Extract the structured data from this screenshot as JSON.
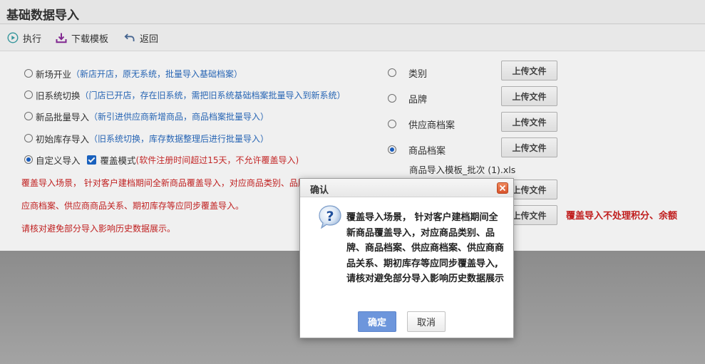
{
  "header": {
    "title": "基础数据导入"
  },
  "toolbar": {
    "run_label": "执行",
    "download_label": "下载模板",
    "back_label": "返回"
  },
  "import_options": [
    {
      "label": "新场开业",
      "note": "（新店开店，原无系统，批量导入基础档案）",
      "checked": false
    },
    {
      "label": "旧系统切换",
      "note": "（门店已开店，存在旧系统，需把旧系统基础档案批量导入到新系统）",
      "checked": false
    },
    {
      "label": "新品批量导入",
      "note": "（新引进供应商新增商品，商品档案批量导入）",
      "checked": false
    },
    {
      "label": "初始库存导入",
      "note": "（旧系统切换，库存数据整理后进行批量导入）",
      "checked": false
    },
    {
      "label": "自定义导入",
      "checked": true
    }
  ],
  "overwrite": {
    "label": "覆盖模式",
    "warning": "(软件注册时间超过15天，不允许覆盖导入)",
    "checked": true
  },
  "overwrite_description": {
    "line1": "覆盖导入场景， 针对客户建档期间全新商品覆盖导入，对应商品类别、品牌",
    "line2": "应商档案、供应商商品关系、期初库存等应同步覆盖导入。",
    "line3": "请核对避免部分导入影响历史数据展示。"
  },
  "categories": [
    {
      "label": "类别",
      "checked": false
    },
    {
      "label": "品牌",
      "checked": false
    },
    {
      "label": "供应商档案",
      "checked": false
    },
    {
      "label": "商品档案",
      "checked": true
    }
  ],
  "upload_label": "上传文件",
  "uploaded_file": "商品导入模板_批次 (1).xls",
  "side_warning": "覆盖导入不处理积分、余额",
  "dialog": {
    "title": "确认",
    "message": "覆盖导入场景， 针对客户建档期间全新商品覆盖导入，对应商品类别、品牌、商品档案、供应商档案、供应商商品关系、期初库存等应同步覆盖导入,请核对避免部分导入影响历史数据展示",
    "confirm_label": "确定",
    "cancel_label": "取消"
  },
  "colors": {
    "note_blue": "#2a6cc0",
    "warning_red": "#cc2222",
    "confirm_blue": "#6d96dc",
    "radio_checked": "#1b62c8"
  }
}
